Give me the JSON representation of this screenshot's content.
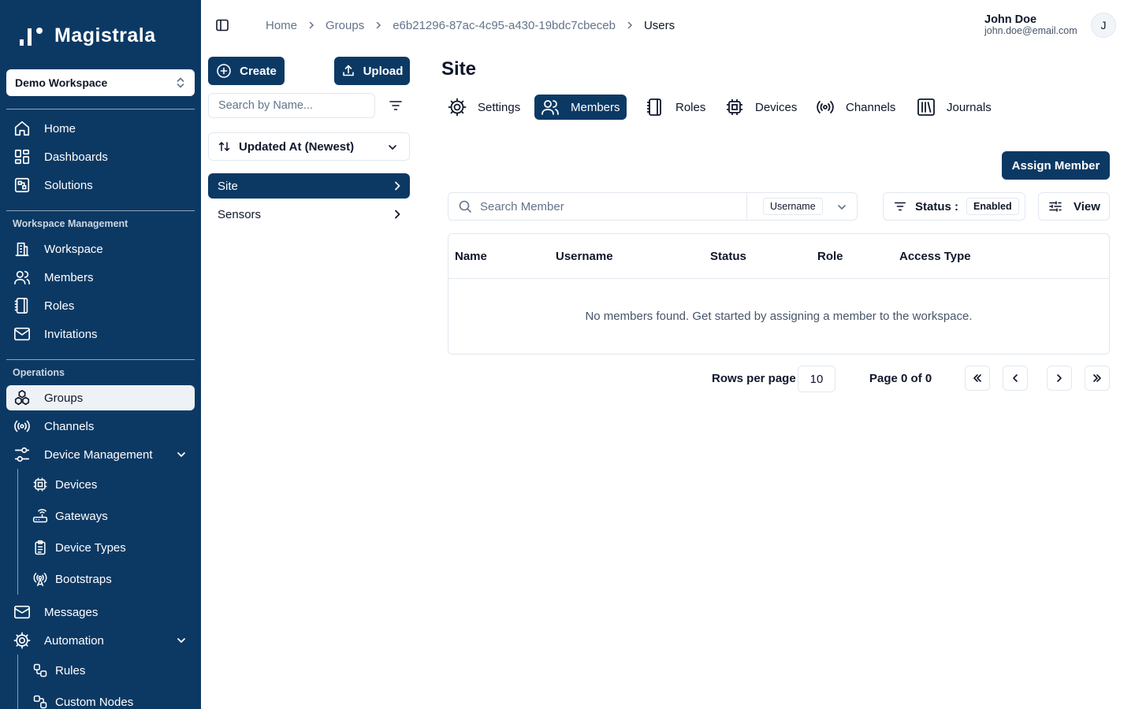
{
  "app": {
    "name": "Magistrala"
  },
  "sidebar": {
    "workspace": "Demo Workspace",
    "top_items": [
      {
        "label": "Home",
        "icon": "home-icon"
      },
      {
        "label": "Dashboards",
        "icon": "dashboard-icon"
      },
      {
        "label": "Solutions",
        "icon": "solutions-icon"
      }
    ],
    "section_workspace": "Workspace Management",
    "workspace_items": [
      {
        "label": "Workspace",
        "icon": "building-icon"
      },
      {
        "label": "Members",
        "icon": "users-icon"
      },
      {
        "label": "Roles",
        "icon": "notebook-icon"
      },
      {
        "label": "Invitations",
        "icon": "mail-icon"
      }
    ],
    "section_operations": "Operations",
    "operations_items": [
      {
        "label": "Groups",
        "icon": "boxes-icon",
        "active": true
      },
      {
        "label": "Channels",
        "icon": "radio-icon"
      },
      {
        "label": "Device Management",
        "icon": "device-management-icon"
      }
    ],
    "device_sub_items": [
      {
        "label": "Devices",
        "icon": "cpu-icon"
      },
      {
        "label": "Gateways",
        "icon": "router-icon"
      },
      {
        "label": "Device Types",
        "icon": "clipboard-icon"
      },
      {
        "label": "Bootstraps",
        "icon": "antenna-icon"
      }
    ],
    "bottom_items": [
      {
        "label": "Messages",
        "icon": "mail-open-icon"
      },
      {
        "label": "Automation",
        "icon": "gear-icon"
      }
    ],
    "automation_sub_items": [
      {
        "label": "Rules",
        "icon": "workflow-icon"
      },
      {
        "label": "Custom Nodes",
        "icon": "custom-nodes-icon"
      }
    ]
  },
  "header": {
    "breadcrumbs": [
      "Home",
      "Groups",
      "e6b21296-87ac-4c95-a430-19bdc7cbeceb",
      "Users"
    ],
    "user_name": "John Doe",
    "user_email": "john.doe@email.com",
    "avatar_initial": "J"
  },
  "groups_panel": {
    "create_label": "Create",
    "upload_label": "Upload",
    "search_placeholder": "Search by Name...",
    "sort_label": "Updated At (Newest)",
    "items": [
      {
        "label": "Site",
        "active": true
      },
      {
        "label": "Sensors",
        "active": false
      }
    ]
  },
  "main": {
    "title": "Site",
    "tabs": [
      {
        "label": "Settings",
        "icon": "settings-icon"
      },
      {
        "label": "Members",
        "icon": "users-icon",
        "active": true
      },
      {
        "label": "Roles",
        "icon": "notebook-icon"
      },
      {
        "label": "Devices",
        "icon": "cpu-icon"
      },
      {
        "label": "Channels",
        "icon": "radio-icon"
      },
      {
        "label": "Journals",
        "icon": "library-icon"
      }
    ],
    "assign_label": "Assign Member",
    "search_placeholder": "Search Member",
    "search_field": "Username",
    "status_label": "Status :",
    "status_value": "Enabled",
    "view_label": "View",
    "columns": [
      "Name",
      "Username",
      "Status",
      "Role",
      "Access Type"
    ],
    "empty_message": "No members found. Get started by assigning a member to the workspace.",
    "pagination": {
      "rows_label": "Rows per page",
      "rows_value": "10",
      "page_info": "Page 0 of 0"
    }
  },
  "colors": {
    "primary": "#0c3964",
    "border": "#e2e8f0",
    "muted_text": "#64748b"
  }
}
